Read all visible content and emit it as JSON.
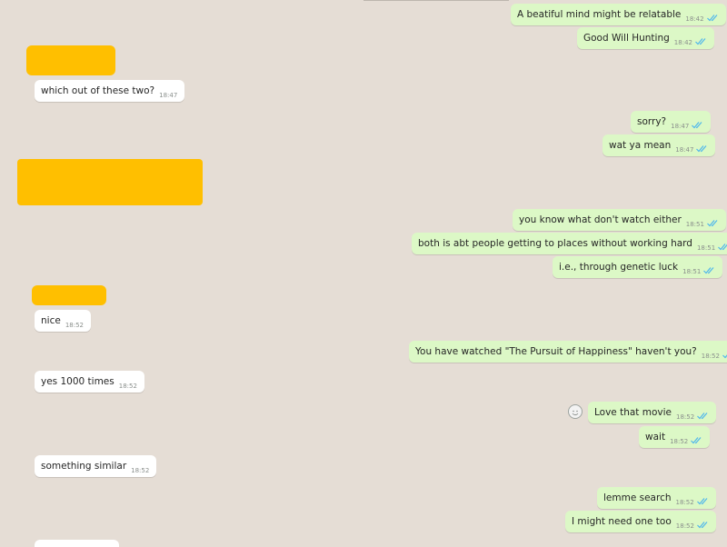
{
  "colors": {
    "background": "#e5ddd5",
    "outgoing_bubble": "#dcf8c6",
    "incoming_bubble": "#ffffff",
    "redaction": "#ffbf00",
    "read_tick": "#4fb6ec"
  },
  "messages": [
    {
      "text": "A beatiful mind might be relatable",
      "time": "18:42",
      "direction": "outgoing",
      "status": "read"
    },
    {
      "text": "Good Will Hunting",
      "time": "18:42",
      "direction": "outgoing",
      "status": "read"
    },
    {
      "text": "which out of these two?",
      "time": "18:47",
      "direction": "incoming"
    },
    {
      "text": "sorry?",
      "time": "18:47",
      "direction": "outgoing",
      "status": "read"
    },
    {
      "text": "wat ya mean",
      "time": "18:47",
      "direction": "outgoing",
      "status": "read"
    },
    {
      "text": "you know what don't watch either",
      "time": "18:51",
      "direction": "outgoing",
      "status": "read"
    },
    {
      "text": "both is abt people getting to places without working hard",
      "time": "18:51",
      "direction": "outgoing",
      "status": "read"
    },
    {
      "text": "i.e., through genetic luck",
      "time": "18:51",
      "direction": "outgoing",
      "status": "read"
    },
    {
      "text": "nice",
      "time": "18:52",
      "direction": "incoming"
    },
    {
      "text": "You have watched \"The Pursuit of Happiness\" haven't you?",
      "time": "18:52",
      "direction": "outgoing",
      "status": "read"
    },
    {
      "text": "yes 1000 times",
      "time": "18:52",
      "direction": "incoming"
    },
    {
      "text": "Love that movie",
      "time": "18:52",
      "direction": "outgoing",
      "status": "read",
      "reaction_icon": "smiley-icon"
    },
    {
      "text": "wait",
      "time": "18:52",
      "direction": "outgoing",
      "status": "read"
    },
    {
      "text": "something similar",
      "time": "18:52",
      "direction": "incoming"
    },
    {
      "text": "lemme search",
      "time": "18:52",
      "direction": "outgoing",
      "status": "read"
    },
    {
      "text": "I might need one too",
      "time": "18:52",
      "direction": "outgoing",
      "status": "read"
    }
  ],
  "icons": {
    "read_receipt": "double-check-icon",
    "reaction": "smiley-icon"
  }
}
